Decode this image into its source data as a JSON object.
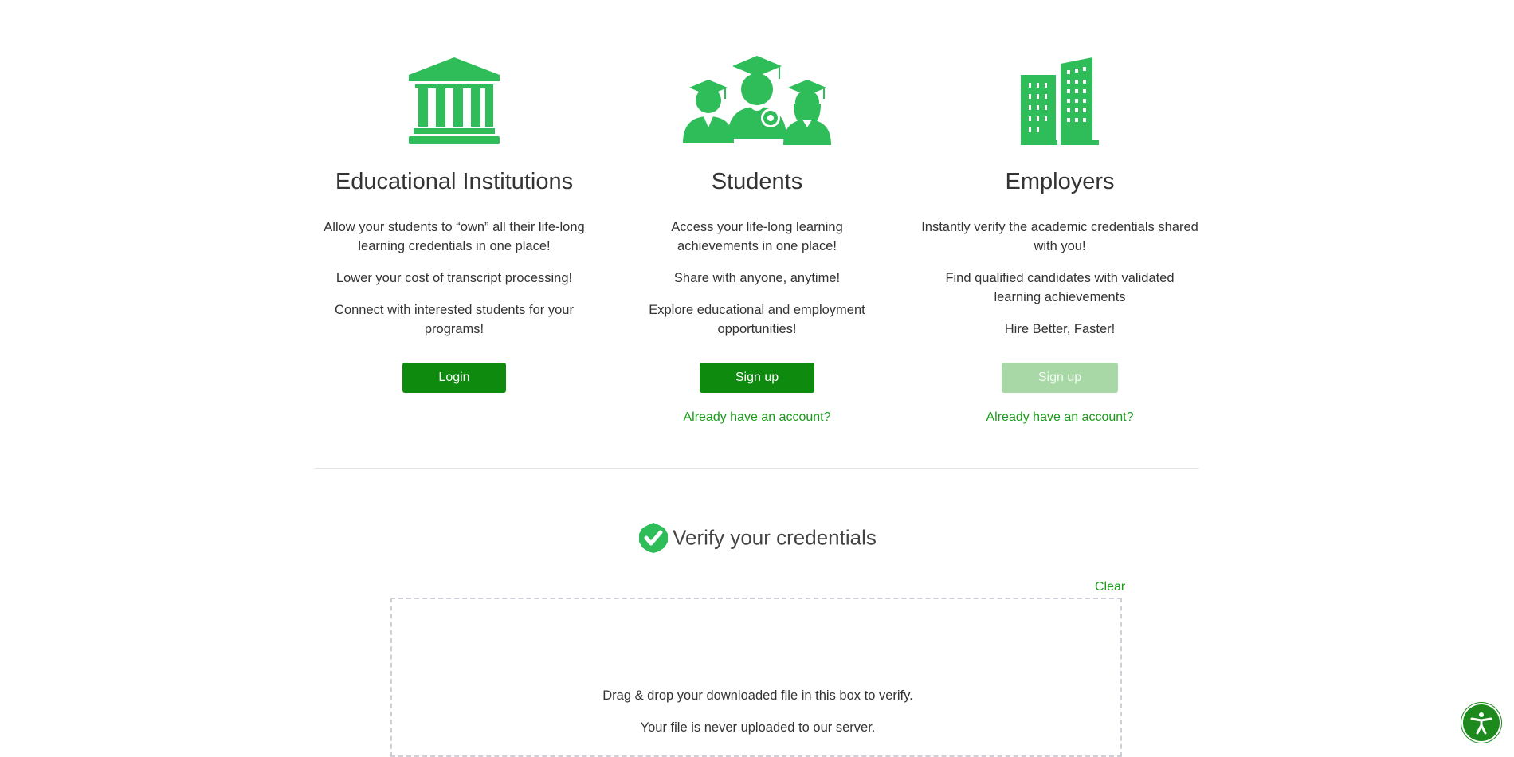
{
  "colors": {
    "accent": "#2ebd59",
    "button": "#0e8a0e",
    "button_disabled": "#a8d8a6",
    "link": "#1a9b1a"
  },
  "institutions": {
    "icon": "bank-building-icon",
    "title": "Educational Institutions",
    "lines": [
      "Allow your students to “own” all their life-long learning credentials in one place!",
      "Lower your cost of transcript processing!",
      "Connect with interested students for your programs!"
    ],
    "button": "Login"
  },
  "students": {
    "icon": "graduates-icon",
    "title": "Students",
    "lines": [
      "Access your life-long learning achievements in one place!",
      "Share with anyone, anytime!",
      "Explore educational and employment opportunities!"
    ],
    "button": "Sign up",
    "link": "Already have an account?"
  },
  "employers": {
    "icon": "office-buildings-icon",
    "title": "Employers",
    "lines": [
      "Instantly verify the academic credentials shared with you!",
      "Find qualified candidates with validated learning achievements",
      "Hire Better, Faster!"
    ],
    "button": "Sign up",
    "link": "Already have an account?"
  },
  "verify": {
    "icon": "verified-check-icon",
    "title": "Verify your credentials",
    "clear": "Clear",
    "drop_text": "Drag & drop your downloaded file in this box to verify.",
    "privacy_text": "Your file is never uploaded to our server."
  },
  "accessibility": {
    "icon": "accessibility-icon"
  }
}
